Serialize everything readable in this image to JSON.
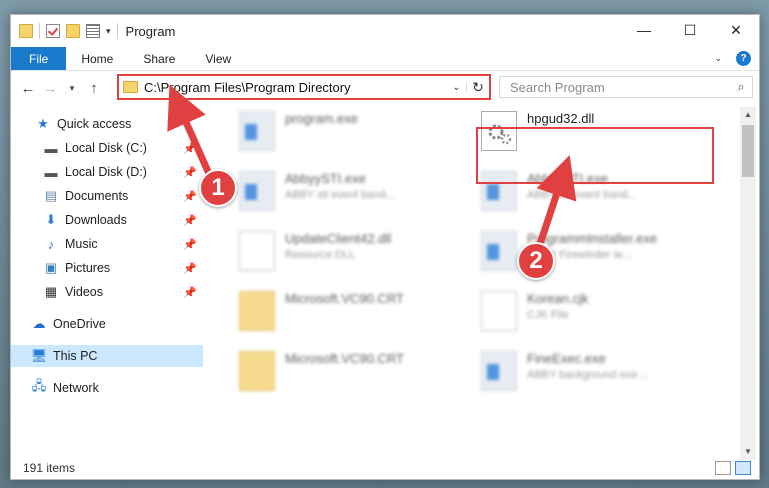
{
  "window": {
    "title": "Program",
    "controls": {
      "minimize": "—",
      "maximize": "☐",
      "close": "✕"
    }
  },
  "ribbon": {
    "tabs": [
      {
        "label": "File"
      },
      {
        "label": "Home"
      },
      {
        "label": "Share"
      },
      {
        "label": "View"
      }
    ]
  },
  "navbar": {
    "address": "C:\\Program Files\\Program Directory",
    "search_placeholder": "Search Program"
  },
  "sidebar": {
    "items": [
      {
        "label": "Quick access",
        "icon": "star-icon"
      },
      {
        "label": "Local Disk (C:)",
        "icon": "drive-icon"
      },
      {
        "label": "Local Disk (D:)",
        "icon": "drive-icon"
      },
      {
        "label": "Documents",
        "icon": "documents-icon"
      },
      {
        "label": "Downloads",
        "icon": "download-icon"
      },
      {
        "label": "Music",
        "icon": "music-icon"
      },
      {
        "label": "Pictures",
        "icon": "pictures-icon"
      },
      {
        "label": "Videos",
        "icon": "videos-icon"
      },
      {
        "label": "OneDrive",
        "icon": "cloud-icon"
      },
      {
        "label": "This PC",
        "icon": "computer-icon"
      },
      {
        "label": "Network",
        "icon": "network-icon"
      }
    ]
  },
  "files": [
    {
      "name": "program.exe",
      "desc": ""
    },
    {
      "name": "hpgud32.dll",
      "desc": ""
    },
    {
      "name": "AbbyySTI.exe",
      "desc": "ABBY sti event band..."
    },
    {
      "name": "AbbyySTI.exe",
      "desc": "ABBY sti event band..."
    },
    {
      "name": "UpdateClient42.dll",
      "desc": "Resource DLL"
    },
    {
      "name": "ProgrammInstaller.exe",
      "desc": "ABBY Firewinder te..."
    },
    {
      "name": "Microsoft.VC90.CRT",
      "desc": ""
    },
    {
      "name": "Korean.cjk",
      "desc": "CJK File"
    },
    {
      "name": "Microsoft.VC90.CRT",
      "desc": ""
    },
    {
      "name": "FineExec.exe",
      "desc": "ABBY background exe..."
    }
  ],
  "status": {
    "count": "191 items"
  },
  "annotations": {
    "step1": "1",
    "step2": "2",
    "color": "#e04040"
  }
}
